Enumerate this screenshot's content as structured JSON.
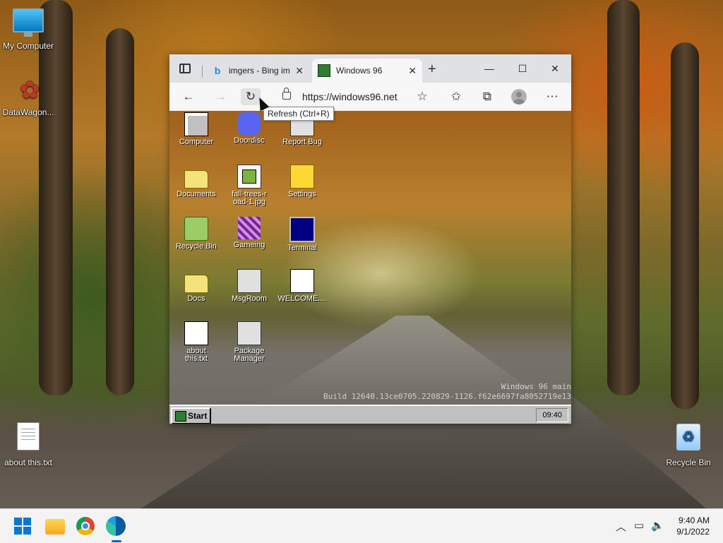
{
  "desktop": {
    "icons": [
      {
        "label": "My Computer"
      },
      {
        "label": "DataWagon..."
      },
      {
        "label": "about this.txt"
      },
      {
        "label": "Recycle Bin"
      }
    ]
  },
  "browser": {
    "tabs": [
      {
        "label": "imgers - Bing im",
        "active": false
      },
      {
        "label": "Windows 96",
        "active": true
      }
    ],
    "url": "https://windows96.net",
    "tooltip": "Refresh (Ctrl+R)"
  },
  "win96": {
    "icons": [
      {
        "label": "Computer"
      },
      {
        "label": "Doordisc"
      },
      {
        "label": "Report Bug"
      },
      {
        "label": "Documents"
      },
      {
        "label": "fall-trees-road-1.jpg"
      },
      {
        "label": "Settings"
      },
      {
        "label": "Recycle Bin"
      },
      {
        "label": "Gameing"
      },
      {
        "label": "Terminal"
      },
      {
        "label": "Docs"
      },
      {
        "label": "MsgRoom"
      },
      {
        "label": "WELCOME...."
      },
      {
        "label": "about this.txt"
      },
      {
        "label": "Package Manager"
      }
    ],
    "build_line1": "Windows 96 main",
    "build_line2": "Build 12640.13ce0705.220829-1126.f62e6697fa8052719e13",
    "start_label": "Start",
    "clock": "09:40"
  },
  "taskbar": {
    "time": "9:40 AM",
    "date": "9/1/2022"
  }
}
